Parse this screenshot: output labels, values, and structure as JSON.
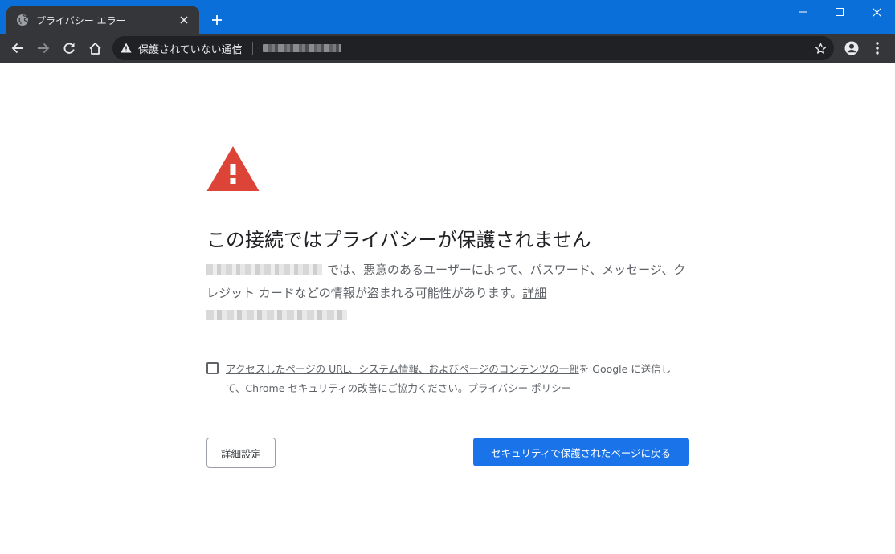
{
  "browser": {
    "tab_title": "プライバシー エラー",
    "security_label": "保護されていない通信"
  },
  "page": {
    "heading": "この接続ではプライバシーが保護されません",
    "body_text": "では、悪意のあるユーザーによって、パスワード、メッセージ、クレジット カードなどの情報が盗まれる可能性があります。",
    "learn_more_link": "詳細",
    "checkbox_link": "アクセスしたページの URL、システム情報、およびページのコンテンツの一部",
    "checkbox_text_mid": "を Google に送信して、Chrome セキュリティの改善にご協力ください。",
    "privacy_policy_link": "プライバシー ポリシー",
    "advanced_button": "詳細設定",
    "back_button": "セキュリティで保護されたページに戻る"
  },
  "colors": {
    "tab_bar": "#0b6fd9",
    "toolbar": "#35363a",
    "warning_red": "#db4437",
    "primary_button": "#1a73e8"
  },
  "icons": {
    "tab_favicon": "globe-icon",
    "tab_close": "close-icon",
    "new_tab": "plus-icon",
    "back": "arrow-left-icon",
    "forward": "arrow-right-icon",
    "reload": "reload-icon",
    "home": "home-icon",
    "security": "warning-icon",
    "bookmark": "star-icon",
    "profile": "account-icon",
    "menu": "kebab-menu-icon"
  }
}
